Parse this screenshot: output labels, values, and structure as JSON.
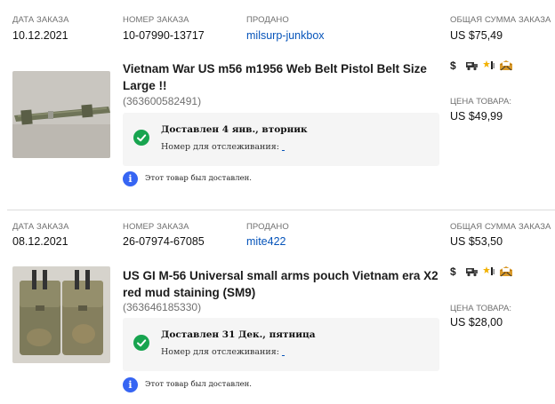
{
  "labels": {
    "order_date": "ДАТА ЗАКАЗА",
    "order_number": "НОМЕР ЗАКАЗА",
    "sold_by": "ПРОДАНО",
    "order_total": "ОБЩАЯ СУММА ЗАКАЗА",
    "item_price": "ЦЕНА ТОВАРА:",
    "tracking_number": "Номер для отслеживания:",
    "delivered_note": "Этот товар был доставлен."
  },
  "orders": [
    {
      "date": "10.12.2021",
      "number": "10-07990-13717",
      "seller": "milsurp-junkbox",
      "total": "US $75,49",
      "item_title": "Vietnam War US m56 m1956 Web Belt Pistol Belt Size Large !!",
      "item_id": "(363600582491)",
      "delivery_status": "Доставлен 4 янв., вторник",
      "item_price": "US $49,99"
    },
    {
      "date": "08.12.2021",
      "number": "26-07974-67085",
      "seller": "mite422",
      "total": "US $53,50",
      "item_title": "US GI M-56 Universal small arms pouch Vietnam era X2 red mud staining (SM9)",
      "item_id": "(363646185330)",
      "delivery_status": "Доставлен 31 Дек., пятница",
      "item_price": "US $28,00"
    }
  ],
  "icons": [
    "dollar-icon",
    "shipping-icon",
    "feedback-star-icon",
    "message-icon"
  ],
  "colors": {
    "link": "#0654ba",
    "success": "#17a44f",
    "info": "#3665f3",
    "label": "#707070",
    "status_bg": "#f5f5f5"
  }
}
